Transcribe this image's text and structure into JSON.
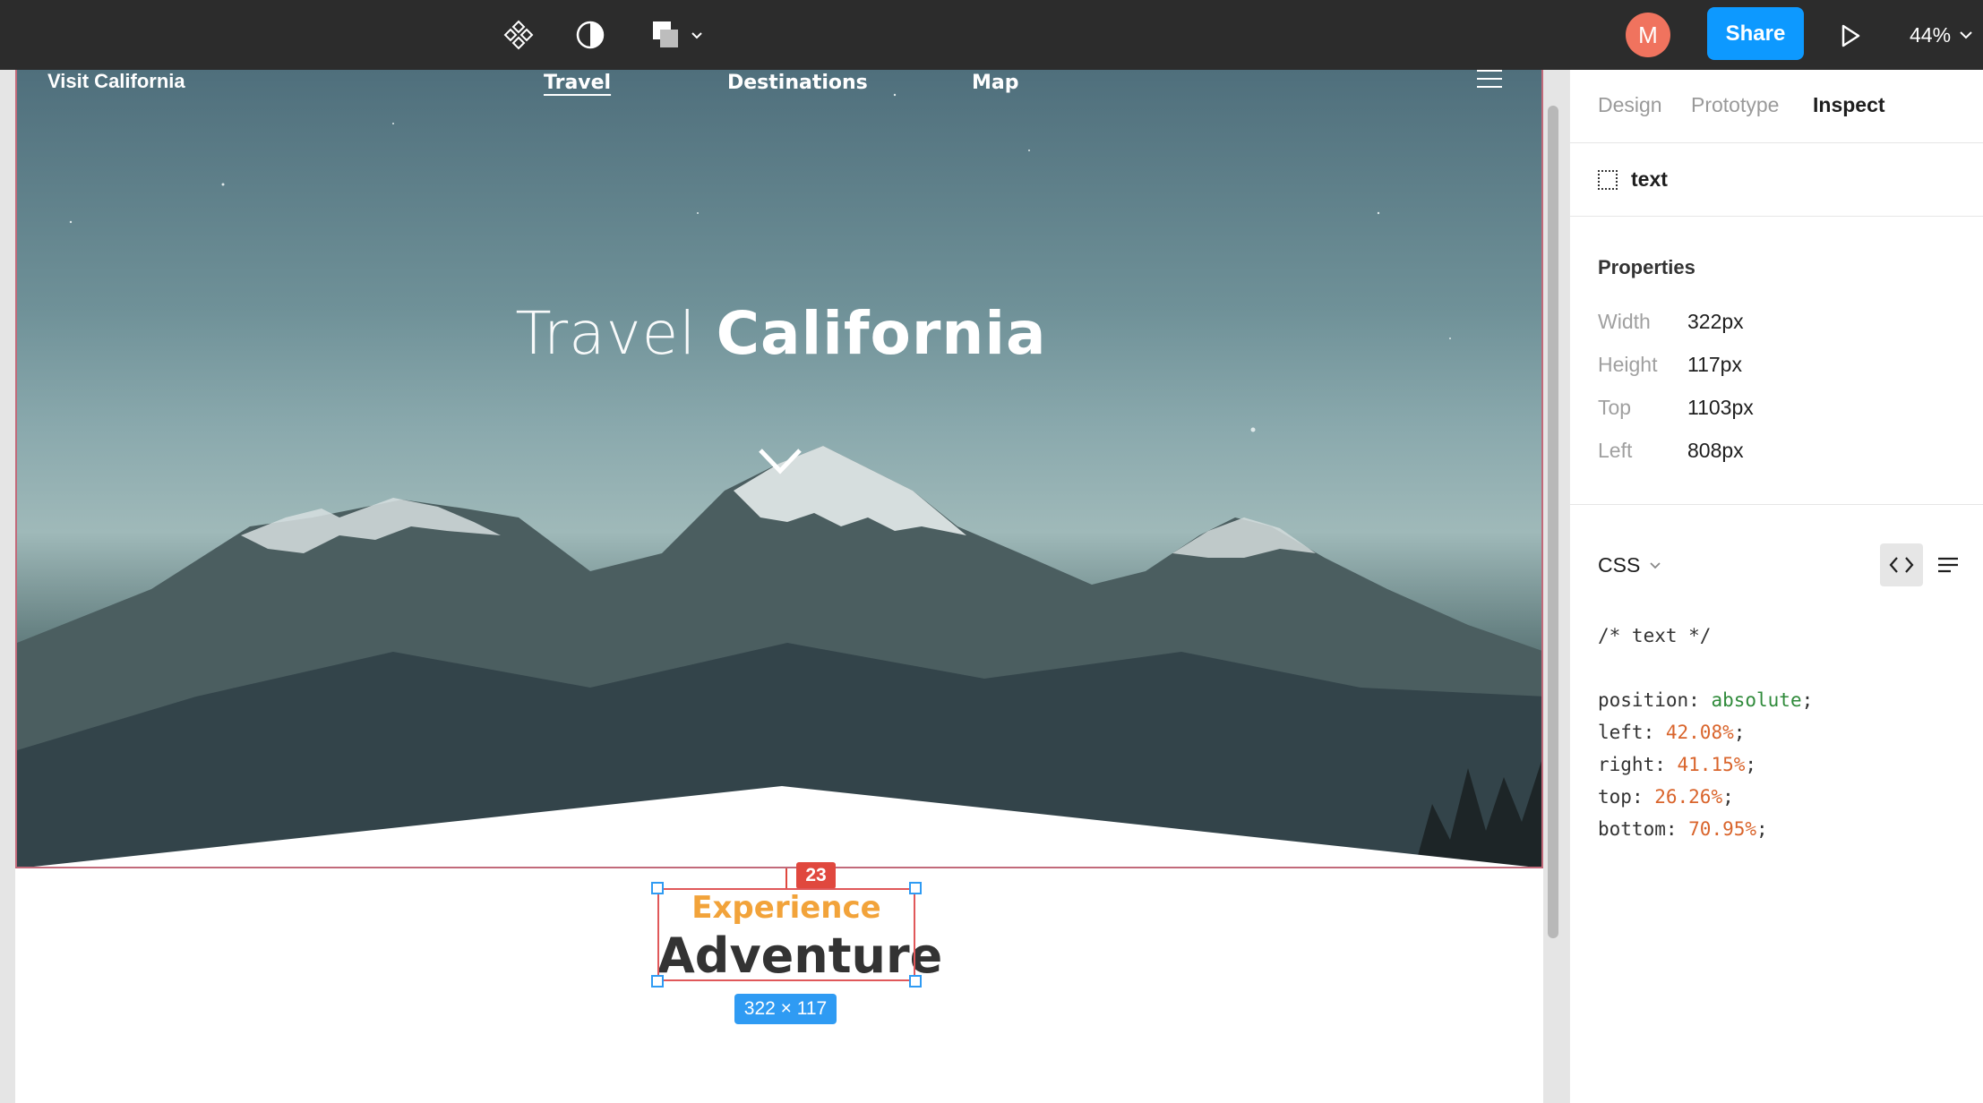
{
  "toolbar": {
    "avatar_initial": "M",
    "share_label": "Share",
    "zoom_label": "44%",
    "icons": [
      "components-icon",
      "contrast-icon",
      "shapes-icon",
      "play-icon"
    ]
  },
  "site": {
    "logo": "Visit California",
    "nav": [
      "Travel",
      "Destinations",
      "Map"
    ],
    "active_nav": "Travel",
    "hero_light": "Travel",
    "hero_bold": "California",
    "section_kicker": "Experience",
    "section_title": "Adventure"
  },
  "canvas": {
    "gap_value": "23",
    "size_label": "322 × 117"
  },
  "panel": {
    "tabs": [
      "Design",
      "Prototype",
      "Inspect"
    ],
    "active_tab": "Inspect",
    "layer_name": "text",
    "properties_title": "Properties",
    "properties": [
      {
        "label": "Width",
        "value": "322px"
      },
      {
        "label": "Height",
        "value": "117px"
      },
      {
        "label": "Top",
        "value": "1103px"
      },
      {
        "label": "Left",
        "value": "808px"
      }
    ],
    "css_label": "CSS",
    "css_comment": "/* text */",
    "css_lines": [
      {
        "prop": "position",
        "value": "absolute",
        "kind": "keyword"
      },
      {
        "prop": "left",
        "value": "42.08%",
        "kind": "number"
      },
      {
        "prop": "right",
        "value": "41.15%",
        "kind": "number"
      },
      {
        "prop": "top",
        "value": "26.26%",
        "kind": "number"
      },
      {
        "prop": "bottom",
        "value": "70.95%",
        "kind": "number"
      }
    ]
  },
  "colors": {
    "toolbar_bg": "#2c2c2c",
    "share_blue": "#0d99ff",
    "avatar": "#f0735e",
    "kicker_orange": "#f2a33a",
    "selection_red": "#e0585a",
    "measure_blue": "#2f9bf3"
  }
}
